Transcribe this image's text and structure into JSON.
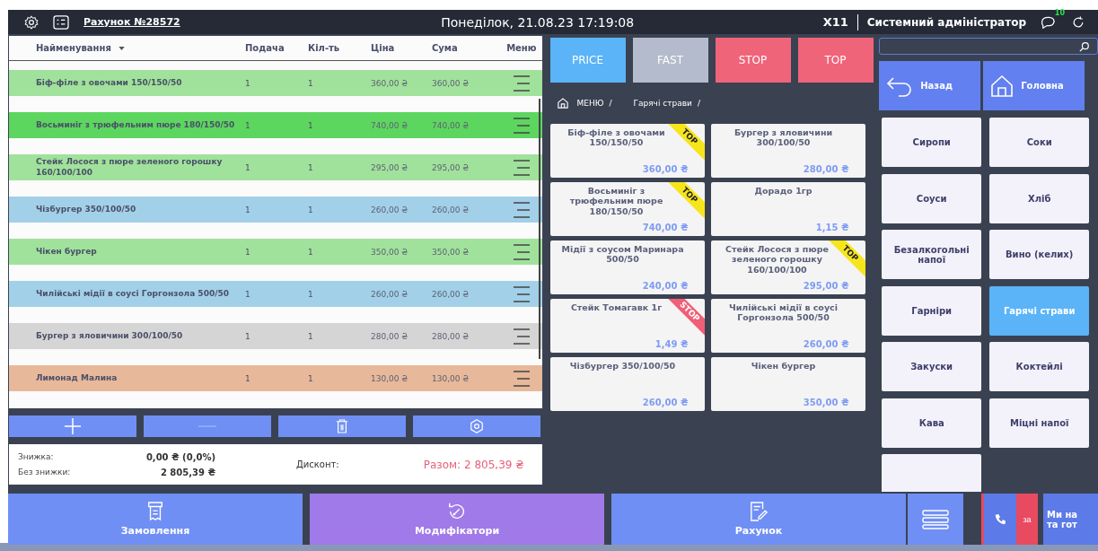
{
  "header": {
    "title": "Рахунок №28572",
    "datetime": "Понеділок, 21.08.23 17:19:08",
    "terminal": "X11",
    "user": "Системний адміністратор",
    "notification_count": "10"
  },
  "order": {
    "columns": [
      "Найменування",
      "Подача",
      "Кіл-ть",
      "Ціна",
      "Сума",
      "Меню"
    ],
    "rows": [
      {
        "name": "Біф-філе з овочами 150/150/50",
        "serving": "1",
        "qty": "1",
        "price": "360,00 ₴",
        "sum": "360,00 ₴",
        "color": "#a0e29b"
      },
      {
        "name": "Восьминіг з трюфельним пюре 180/150/50",
        "serving": "1",
        "qty": "1",
        "price": "740,00 ₴",
        "sum": "740,00 ₴",
        "color": "#5cd65f"
      },
      {
        "name": "Стейк Лосося з пюре зеленого горошку 160/100/100",
        "serving": "1",
        "qty": "1",
        "price": "295,00 ₴",
        "sum": "295,00 ₴",
        "color": "#a0e29b"
      },
      {
        "name": "Чізбургер 350/100/50",
        "serving": "1",
        "qty": "1",
        "price": "260,00 ₴",
        "sum": "260,00 ₴",
        "color": "#a2d0e8"
      },
      {
        "name": "Чікен бургер",
        "serving": "1",
        "qty": "1",
        "price": "350,00 ₴",
        "sum": "350,00 ₴",
        "color": "#a0e29b"
      },
      {
        "name": "Чилійські мідії в соусі Горгонзола 500/50",
        "serving": "1",
        "qty": "1",
        "price": "260,00 ₴",
        "sum": "260,00 ₴",
        "color": "#a2d0e8"
      },
      {
        "name": "Бургер з яловичини 300/100/50",
        "serving": "1",
        "qty": "1",
        "price": "280,00 ₴",
        "sum": "280,00 ₴",
        "color": "#d5d5d5"
      },
      {
        "name": "Лимонад Малина",
        "serving": "1",
        "qty": "1",
        "price": "130,00 ₴",
        "sum": "130,00 ₴",
        "color": "#e8b89a"
      }
    ]
  },
  "summary": {
    "discount_label": "Знижка:",
    "discount_value": "0,00 ₴ (0,0%)",
    "without_label": "Без знижки:",
    "without_value": "2 805,39 ₴",
    "card_label": "Дисконт:",
    "total": "Разом: 2 805,39 ₴"
  },
  "filters": [
    {
      "label": "PRICE",
      "color": "#5ab4f7"
    },
    {
      "label": "FAST",
      "color": "#b4bbcc"
    },
    {
      "label": "STOP",
      "color": "#f0647a"
    },
    {
      "label": "TOP",
      "color": "#f0647a"
    }
  ],
  "breadcrumb": [
    {
      "label": "МЕНЮ",
      "separator": "/"
    },
    {
      "label": "Гарячі страви",
      "separator": "/"
    }
  ],
  "products": [
    {
      "name": "Біф-філе з овочами 150/150/50",
      "price": "360,00 ₴",
      "badge": {
        "kind": "top",
        "label": "TOP"
      }
    },
    {
      "name": "Бургер з яловичини 300/100/50",
      "price": "280,00 ₴"
    },
    {
      "name": "Восьминіг з трюфельним пюре 180/150/50",
      "price": "740,00 ₴",
      "badge": {
        "kind": "top",
        "label": "TOP"
      }
    },
    {
      "name": "Дорадо 1гр",
      "price": "1,15 ₴"
    },
    {
      "name": "Мідії з соусом Маринара 500/50",
      "price": "240,00 ₴"
    },
    {
      "name": "Стейк Лосося з пюре зеленого горошку 160/100/100",
      "price": "295,00 ₴",
      "badge": {
        "kind": "top",
        "label": "TOP"
      }
    },
    {
      "name": "Стейк Томагавк 1г",
      "price": "1,49 ₴",
      "badge": {
        "kind": "stop",
        "label": "STOP"
      }
    },
    {
      "name": "Чилійські мідії в соусі Горгонзола 500/50",
      "price": "260,00 ₴"
    },
    {
      "name": "Чізбургер 350/100/50",
      "price": "260,00 ₴"
    },
    {
      "name": "Чікен бургер",
      "price": "350,00 ₴"
    }
  ],
  "nav": {
    "back": "Назад",
    "home": "Головна"
  },
  "categories": [
    {
      "label": "Сиропи",
      "selected": false
    },
    {
      "label": "Соки",
      "selected": false
    },
    {
      "label": "Соуси",
      "selected": false
    },
    {
      "label": "Хліб",
      "selected": false
    },
    {
      "label": "Безалкогольні напої",
      "selected": false
    },
    {
      "label": "Вино (келих)",
      "selected": false
    },
    {
      "label": "Гарніри",
      "selected": false
    },
    {
      "label": "Гарячі страви",
      "selected": true
    },
    {
      "label": "Закуски",
      "selected": false
    },
    {
      "label": "Коктейлі",
      "selected": false
    },
    {
      "label": "Кава",
      "selected": false
    },
    {
      "label": "Міцні напої",
      "selected": false
    }
  ],
  "more_categories_below": true,
  "bottom": [
    {
      "label": "Замовлення",
      "kind": "receipt",
      "color": "#6f8ff5"
    },
    {
      "label": "Модифікатори",
      "kind": "rotate",
      "color": "#a07ae8"
    },
    {
      "label": "Рахунок",
      "kind": "edit",
      "color": "#6f8ff5"
    }
  ],
  "callout": {
    "hidden_label": "за",
    "lines": [
      "Ми на",
      "та гот"
    ]
  }
}
